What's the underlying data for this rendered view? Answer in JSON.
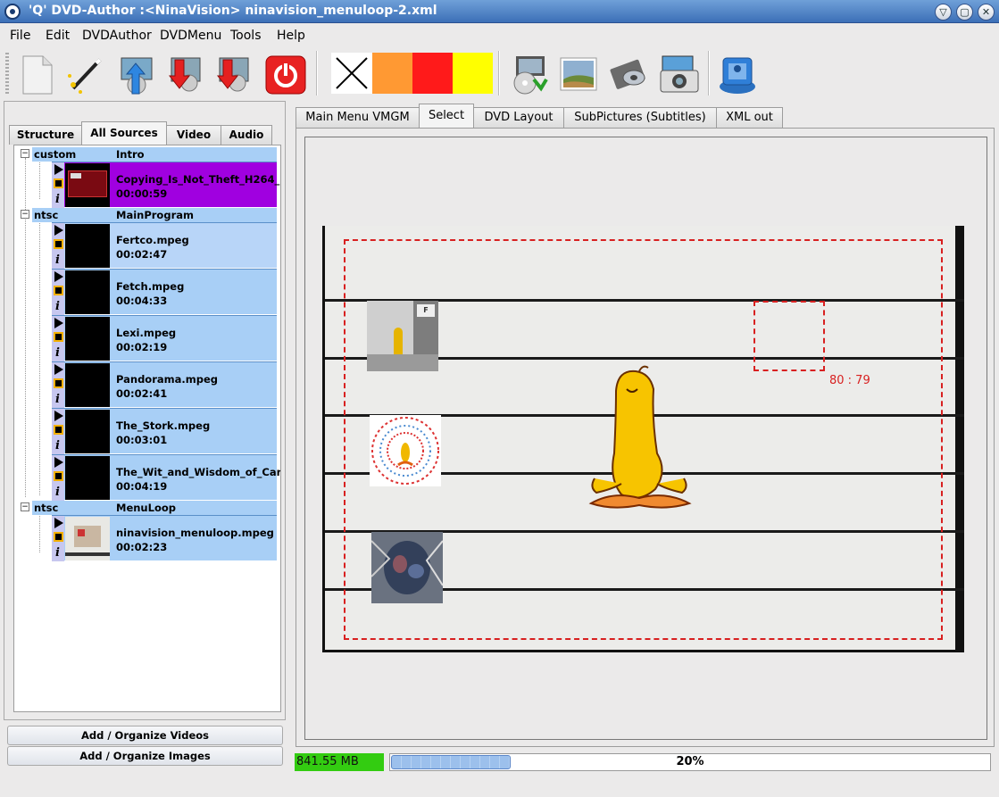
{
  "window": {
    "title": "'Q' DVD-Author :<NinaVision> ninavision_menuloop-2.xml"
  },
  "menubar": {
    "items": [
      {
        "label": "File"
      },
      {
        "label": "Edit"
      },
      {
        "label": "DVDAuthor"
      },
      {
        "label": "DVDMenu"
      },
      {
        "label": "Tools"
      },
      {
        "label": "Help"
      }
    ]
  },
  "toolbar": {
    "swatch_colors": [
      "#ff9933",
      "#ff1a1a",
      "#ffff00"
    ]
  },
  "left_tabs": [
    {
      "label": "Structure"
    },
    {
      "label": "All Sources"
    },
    {
      "label": "Video"
    },
    {
      "label": "Audio"
    }
  ],
  "groups": [
    {
      "format": "custom",
      "name": "Intro",
      "items": [
        {
          "name": "Copying_Is_Not_Theft_H264_",
          "duration": "00:00:59"
        }
      ]
    },
    {
      "format": "ntsc",
      "name": "MainProgram",
      "items": [
        {
          "name": "Fertco.mpeg",
          "duration": "00:02:47"
        },
        {
          "name": "Fetch.mpeg",
          "duration": "00:04:33"
        },
        {
          "name": "Lexi.mpeg",
          "duration": "00:02:19"
        },
        {
          "name": "Pandorama.mpeg",
          "duration": "00:02:41"
        },
        {
          "name": "The_Stork.mpeg",
          "duration": "00:03:01"
        },
        {
          "name": "The_Wit_and_Wisdom_of_Car",
          "duration": "00:04:19"
        }
      ]
    },
    {
      "format": "ntsc",
      "name": "MenuLoop",
      "items": [
        {
          "name": "ninavision_menuloop.mpeg",
          "duration": "00:02:23"
        }
      ]
    }
  ],
  "left_buttons": {
    "add_videos": "Add / Organize Videos",
    "add_images": "Add / Organize Images"
  },
  "right_tabs": [
    {
      "label": "Main Menu VMGM"
    },
    {
      "label": "Select"
    },
    {
      "label": "DVD Layout"
    },
    {
      "label": "SubPictures (Subtitles)"
    },
    {
      "label": "XML out"
    }
  ],
  "menu_editor": {
    "selection_coord": "80 : 79"
  },
  "status": {
    "size": "841.55 MB",
    "progress_text": "20%",
    "progress_fraction": 0.2
  }
}
